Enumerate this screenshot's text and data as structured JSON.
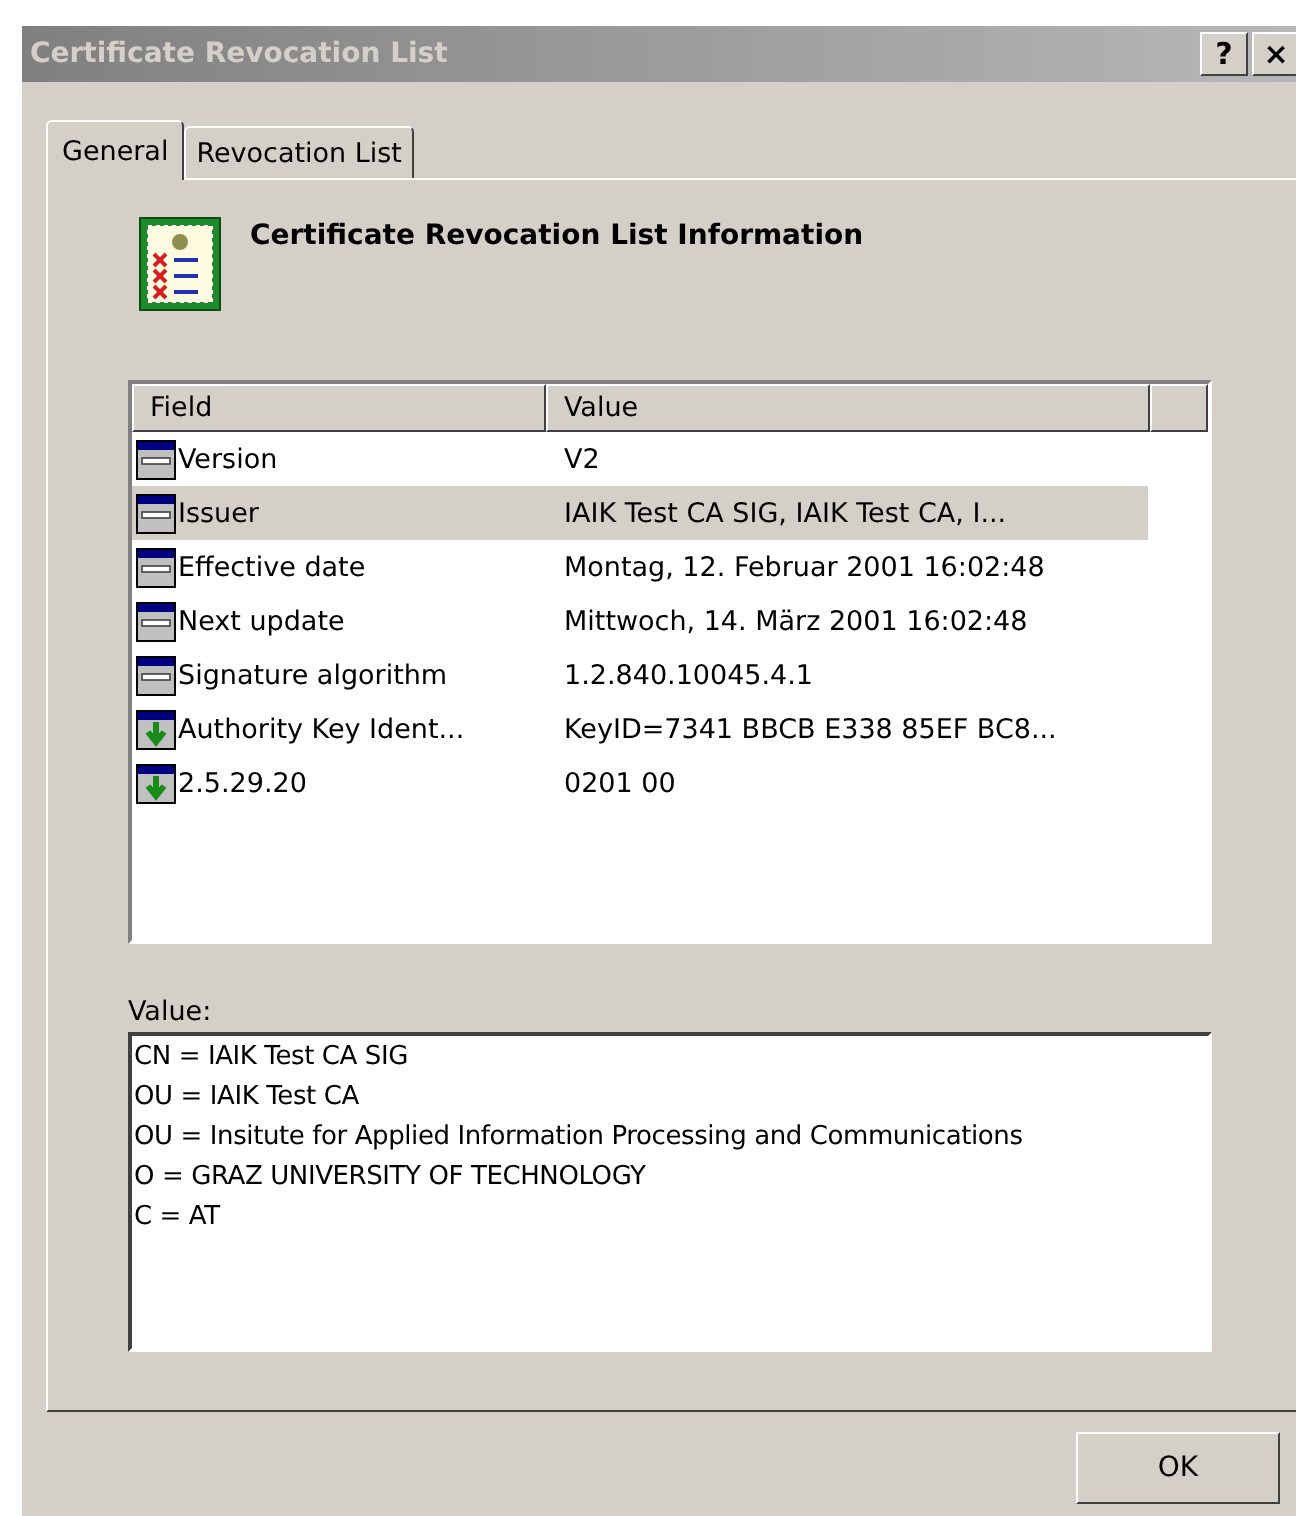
{
  "window": {
    "title": "Certificate Revocation List",
    "help": "?",
    "close": "×"
  },
  "tabs": [
    {
      "label": "General",
      "selected": true
    },
    {
      "label": "Revocation List",
      "selected": false
    }
  ],
  "heading": "Certificate Revocation List Information",
  "table": {
    "columns": [
      "Field",
      "Value"
    ],
    "rows": [
      {
        "kind": "property",
        "field": "Version",
        "value": "V2",
        "selected": false
      },
      {
        "kind": "property",
        "field": "Issuer",
        "value": "IAIK Test CA SIG, IAIK Test CA, I...",
        "selected": true
      },
      {
        "kind": "property",
        "field": "Effective date",
        "value": "Montag, 12. Februar 2001 16:02:48",
        "selected": false
      },
      {
        "kind": "property",
        "field": "Next update",
        "value": "Mittwoch, 14. März 2001 16:02:48",
        "selected": false
      },
      {
        "kind": "property",
        "field": "Signature algorithm",
        "value": "1.2.840.10045.4.1",
        "selected": false
      },
      {
        "kind": "extension",
        "field": "Authority Key Ident...",
        "value": "KeyID=7341 BBCB E338 85EF BC8...",
        "selected": false
      },
      {
        "kind": "extension",
        "field": "2.5.29.20",
        "value": "0201 00",
        "selected": false
      }
    ]
  },
  "value_label": "Value:",
  "value_lines": [
    "CN = IAIK Test CA SIG",
    "OU = IAIK Test CA",
    "OU = Insitute for Applied Information Processing and Communications",
    "O = GRAZ UNIVERSITY OF TECHNOLOGY",
    "C = AT"
  ],
  "buttons": [
    "OK"
  ]
}
